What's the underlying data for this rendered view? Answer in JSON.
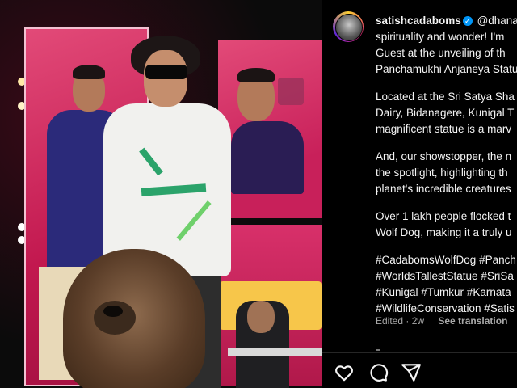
{
  "post": {
    "username": "satishcadaboms",
    "verified_glyph": "✓",
    "caption_line1_rest": "@dhana",
    "caption_lines": "spirituality and wonder! I'm\nGuest at the unveiling of th\nPanchamukhi Anjaneya Statu",
    "para2": "Located at the Sri Satya Sha\nDairy, Bidanagere, Kunigal T\nmagnificent statue is a marv",
    "para3": "And, our showstopper, the n\nthe spotlight, highlighting th\nplanet's incredible creatures",
    "para4": "Over 1 lakh people flocked t\nWolf Dog, making it a truly u",
    "hashtags": "#CadabomsWolfDog #Panch\n#WorldsTallestStatue #SriSa\n#Kunigal #Tumkur #Karnata\n#WildlifeConservation #Satis",
    "edited_label": "Edited · 2w",
    "see_translation": "See translation"
  },
  "actions": {
    "like_icon": "heart-icon",
    "comment_icon": "comment-icon",
    "share_icon": "share-icon"
  },
  "colors": {
    "background": "#000000",
    "text": "#f5f5f5",
    "muted": "#a8a8a8",
    "verified": "#0095f6"
  }
}
